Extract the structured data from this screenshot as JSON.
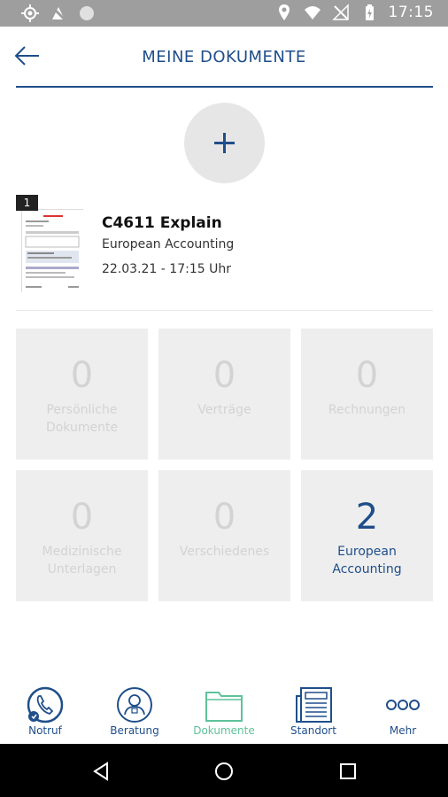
{
  "status_bar": {
    "time": "17:15"
  },
  "header": {
    "title": "MEINE DOKUMENTE"
  },
  "document": {
    "badge": "1",
    "title": "C4611 Explain",
    "subtitle": "European Accounting",
    "date": "22.03.21 - 17:15 Uhr"
  },
  "categories": [
    {
      "count": "0",
      "label_line1": "Persönliche",
      "label_line2": "Dokumente"
    },
    {
      "count": "0",
      "label_line1": "Verträge",
      "label_line2": ""
    },
    {
      "count": "0",
      "label_line1": "Rechnungen",
      "label_line2": ""
    },
    {
      "count": "0",
      "label_line1": "Medizinische",
      "label_line2": "Unterlagen"
    },
    {
      "count": "0",
      "label_line1": "Verschiedenes",
      "label_line2": ""
    },
    {
      "count": "2",
      "label_line1": "European",
      "label_line2": "Accounting"
    }
  ],
  "bottom_nav": [
    {
      "label": "Notruf",
      "icon": "phone-icon"
    },
    {
      "label": "Beratung",
      "icon": "advisor-icon"
    },
    {
      "label": "Dokumente",
      "icon": "folder-icon"
    },
    {
      "label": "Standort",
      "icon": "newspaper-icon"
    },
    {
      "label": "Mehr",
      "icon": "more-dots-icon"
    }
  ],
  "colors": {
    "accent": "#1f4e8a",
    "active": "#5fc29a",
    "tile_bg": "#eeeeee",
    "tile_text_inactive": "#d3d3d3"
  }
}
